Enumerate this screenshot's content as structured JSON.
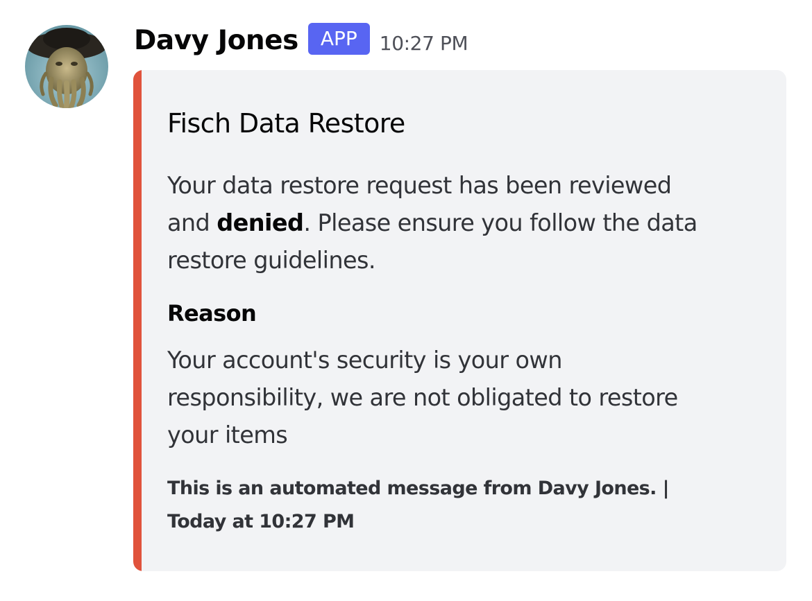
{
  "message": {
    "author": "Davy Jones",
    "badge": "APP",
    "timestamp": "10:27 PM",
    "avatar_icon": "davy-jones-avatar",
    "accent_color": "#e0533c",
    "badge_color": "#5865f2"
  },
  "embed": {
    "title": "Fisch Data Restore",
    "description": {
      "line1": "Your data restore request has been reviewed",
      "line2_prefix": "and ",
      "line2_bold": "denied",
      "line2_suffix": ". Please ensure you follow the data",
      "line3": "restore guidelines."
    },
    "field": {
      "name": "Reason",
      "value_lines": [
        "Your account's security is your own",
        "responsibility, we are not obligated to restore",
        "your items"
      ]
    },
    "footer": {
      "text": "This is an automated message from Davy Jones. |",
      "time": "Today at 10:27 PM"
    }
  }
}
